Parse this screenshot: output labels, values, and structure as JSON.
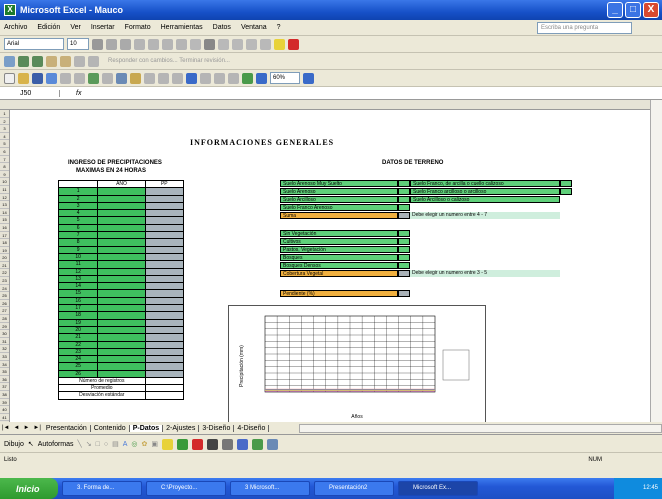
{
  "window": {
    "title": "Microsoft Excel - Mauco",
    "min": "_",
    "max": "□",
    "close": "X"
  },
  "menu": [
    "Archivo",
    "Edición",
    "Ver",
    "Insertar",
    "Formato",
    "Herramientas",
    "Datos",
    "Ventana",
    "?"
  ],
  "ask_placeholder": "Escriba una pregunta",
  "font_name": "Arial",
  "font_size": "10",
  "zoom": "60%",
  "review_text": "Responder con cambios...   Terminar revisión...",
  "name_box": "J50",
  "fx": "fx",
  "sheet": {
    "title": "INFORMACIONES  GENERALES",
    "left_heading_1": "INGRESO DE PRECIPITACIONES",
    "left_heading_2": "MAXIMAS EN 24 HORAS",
    "left_col_head": "AÑO",
    "left_col_head2": "PP",
    "left_rows": [
      "1",
      "2",
      "3",
      "4",
      "5",
      "6",
      "7",
      "8",
      "9",
      "10",
      "11",
      "12",
      "13",
      "14",
      "15",
      "16",
      "17",
      "18",
      "19",
      "20",
      "21",
      "22",
      "23",
      "24",
      "25",
      "26"
    ],
    "left_foot": [
      "Número de registros",
      "Promedio",
      "Desviación estándar"
    ],
    "right_heading": "DATOS DE TERRENO",
    "group1": [
      "Suelo Arenoso Muy Suelto",
      "Suelo Arenoso",
      "Suelo Arcilloso",
      "Suelo Franco Arenoso"
    ],
    "group1_right": [
      "Suelo Franco, de arcilla o cuello calizoso",
      "Suelo Franco arcilloso o arcilloso",
      "Suelo Arcilloso o calizoso"
    ],
    "group1_total": "Suma",
    "group1_note": "Debe elegir un numero entre 4 - 7",
    "group2": [
      "Sin Vegetación",
      "Cultivos",
      "Pastos, Vegetación",
      "Bosques",
      "Bosques Densos"
    ],
    "group2_total": "Cobertura Vegetal",
    "group2_note": "Debe elegir un numero entre 3 - 5",
    "pendiente": "Pendiente (%)"
  },
  "chart_data": {
    "type": "line",
    "xlabel": "Años",
    "ylabel": "Precipitación (mm)",
    "legend": [
      "",
      "",
      "",
      ""
    ],
    "legend_placement": "right",
    "grid": true
  },
  "tabs": [
    "Presentación",
    "Contenido",
    "P-Datos",
    "2-Ajustes",
    "3-Diseño",
    "4-Diseño"
  ],
  "active_tab": "P-Datos",
  "draw": {
    "dibujo": "Dibujo",
    "autoformas": "Autoformas"
  },
  "status": {
    "left": "Listo",
    "right": "NUM"
  },
  "taskbar": {
    "start": "Inicio",
    "items": [
      "3. Forma de...",
      "C:\\Proyecto...",
      "3 Microsoft...",
      "Presentación2",
      "Microsoft Ex..."
    ],
    "clock": "12:45"
  }
}
